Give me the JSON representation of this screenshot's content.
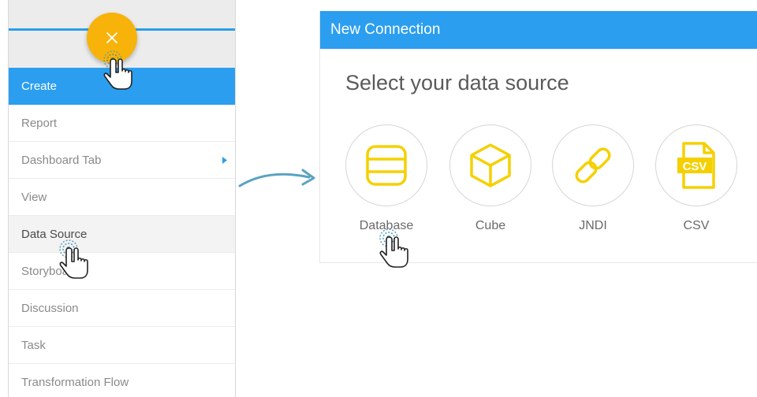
{
  "menu": {
    "items": [
      {
        "label": "Create",
        "state": "active",
        "submenu": false
      },
      {
        "label": "Report",
        "state": "normal",
        "submenu": false
      },
      {
        "label": "Dashboard Tab",
        "state": "normal",
        "submenu": true
      },
      {
        "label": "View",
        "state": "normal",
        "submenu": false
      },
      {
        "label": "Data Source",
        "state": "hover",
        "submenu": false
      },
      {
        "label": "Storyboard",
        "state": "normal",
        "submenu": false
      },
      {
        "label": "Discussion",
        "state": "normal",
        "submenu": false
      },
      {
        "label": "Task",
        "state": "normal",
        "submenu": false
      },
      {
        "label": "Transformation Flow",
        "state": "normal",
        "submenu": false
      }
    ],
    "fab_icon": "close-icon"
  },
  "connection": {
    "title": "New Connection",
    "subtitle": "Select your data source",
    "sources": [
      {
        "label": "Database",
        "icon": "database-icon"
      },
      {
        "label": "Cube",
        "icon": "cube-icon"
      },
      {
        "label": "JNDI",
        "icon": "link-icon"
      },
      {
        "label": "CSV",
        "icon": "csv-file-icon",
        "badge": "CSV"
      }
    ]
  },
  "colors": {
    "primary_blue": "#2b9ef0",
    "accent_yellow": "#f7b30a",
    "icon_yellow": "#f5d000",
    "arrow_teal": "#5aa3c0"
  }
}
